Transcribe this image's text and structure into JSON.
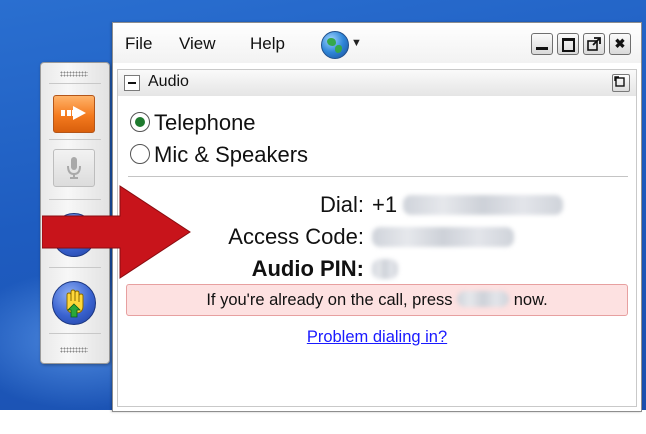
{
  "menu": {
    "file": "File",
    "view": "View",
    "help": "Help"
  },
  "window_controls": [
    "minimize",
    "maximize",
    "pop-out",
    "close"
  ],
  "window_close_glyph": "✖",
  "panel": {
    "title": "Audio",
    "collapse_icon": "minus-box-icon"
  },
  "audio_options": [
    {
      "label": "Telephone",
      "selected": true
    },
    {
      "label": "Mic & Speakers",
      "selected": false
    }
  ],
  "dial_info": {
    "dial_label": "Dial:",
    "dial_prefix": "+1",
    "access_label": "Access Code:",
    "pin_label": "Audio PIN:"
  },
  "notice": {
    "before": "If you're already on the call, press",
    "after": "now."
  },
  "link_text": "Problem dialing in?",
  "colors": {
    "desktop_blue": "#1e5cc0",
    "notice_bg": "#fde1e1",
    "arrow_red": "#c8141b",
    "link_blue": "#1a1aff",
    "toolbar_orange": "#f47a1e"
  },
  "icons": {
    "toolbar": [
      "right-arrow-icon",
      "microphone-icon",
      "blue-circle-icon",
      "raise-hand-icon"
    ],
    "menu_globe": "globe-icon"
  }
}
